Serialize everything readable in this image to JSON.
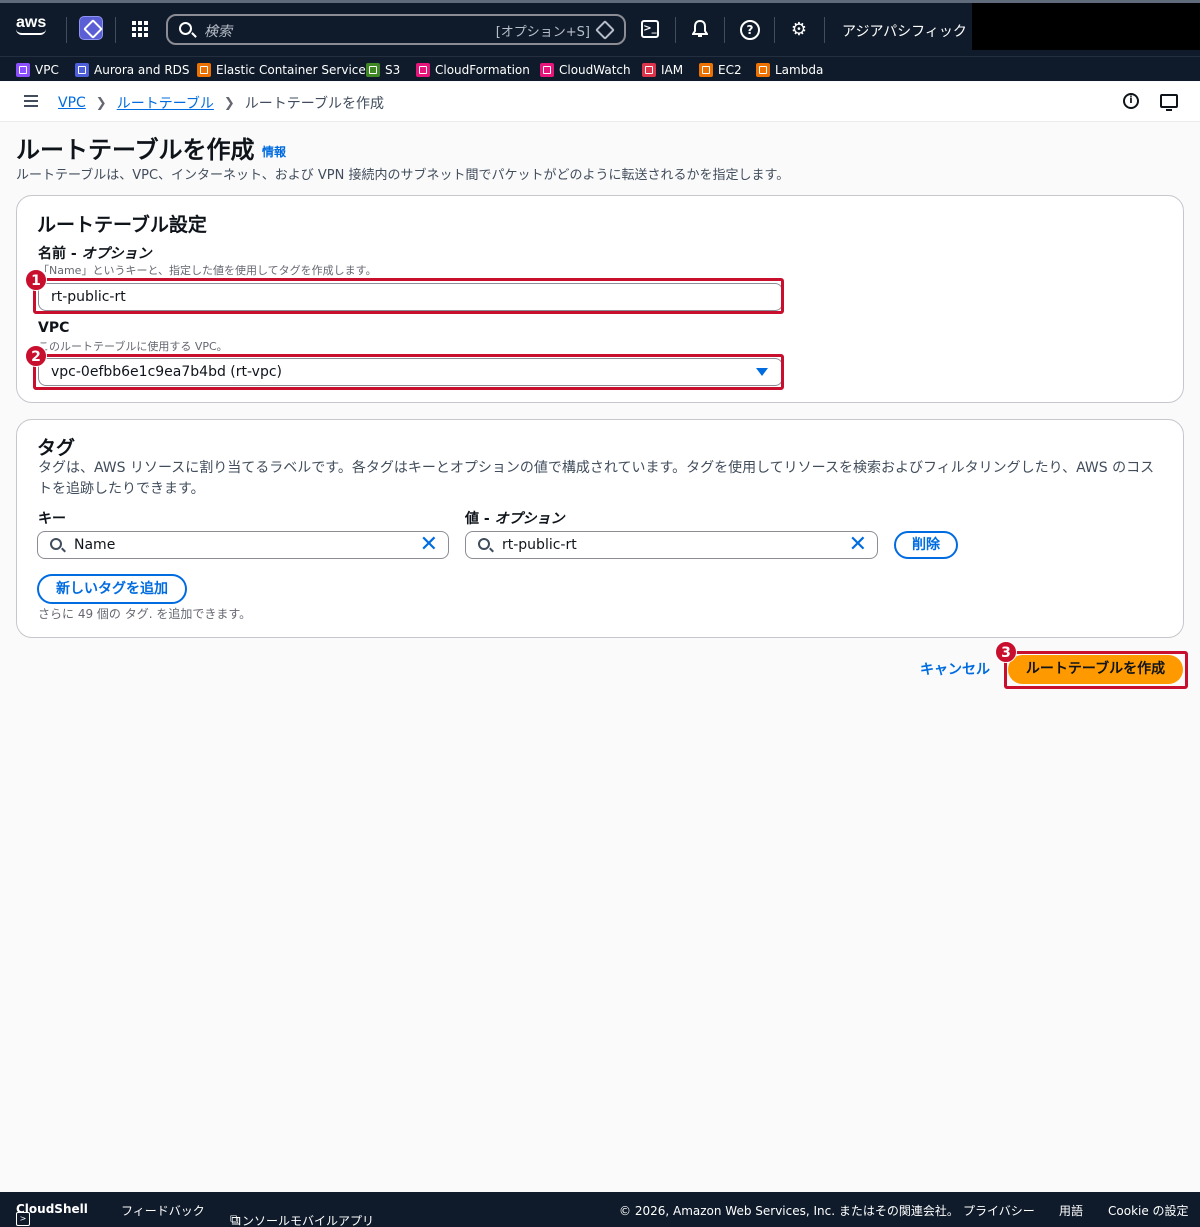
{
  "topbar": {
    "logo_text": "aws",
    "search_placeholder": "検索",
    "search_shortcut": "[オプション+S]",
    "region": "アジアパシフィック (東京)"
  },
  "favorites": [
    {
      "label": "VPC",
      "color": "#8c4fff"
    },
    {
      "label": "Aurora and RDS",
      "color": "#4d5fd9"
    },
    {
      "label": "Elastic Container Service",
      "color": "#ed7100"
    },
    {
      "label": "S3",
      "color": "#3f8624"
    },
    {
      "label": "CloudFormation",
      "color": "#e7157b"
    },
    {
      "label": "CloudWatch",
      "color": "#e7157b"
    },
    {
      "label": "IAM",
      "color": "#dd344c"
    },
    {
      "label": "EC2",
      "color": "#ed7100"
    },
    {
      "label": "Lambda",
      "color": "#ed7100"
    }
  ],
  "breadcrumb": {
    "items": [
      "VPC",
      "ルートテーブル"
    ],
    "current": "ルートテーブルを作成"
  },
  "header": {
    "title": "ルートテーブルを作成",
    "info": "情報",
    "description": "ルートテーブルは、VPC、インターネット、および VPN 接続内のサブネット間でパケットがどのように転送されるかを指定します。"
  },
  "settings": {
    "title": "ルートテーブル設定",
    "name_label": "名前",
    "name_optional": "オプション",
    "name_desc": "「Name」というキーと、指定した値を使用してタグを作成します。",
    "name_value": "rt-public-rt",
    "vpc_label": "VPC",
    "vpc_desc": "このルートテーブルに使用する VPC。",
    "vpc_value": "vpc-0efbb6e1c9ea7b4bd (rt-vpc)"
  },
  "tags": {
    "title": "タグ",
    "description": "タグは、AWS リソースに割り当てるラベルです。各タグはキーとオプションの値で構成されています。タグを使用してリソースを検索およびフィルタリングしたり、AWS のコストを追跡したりできます。",
    "key_label": "キー",
    "value_label": "値",
    "value_optional": "オプション",
    "key_value": "Name",
    "value_value": "rt-public-rt",
    "remove_label": "削除",
    "add_label": "新しいタグを追加",
    "hint": "さらに 49 個の タグ. を追加できます。"
  },
  "actions": {
    "cancel": "キャンセル",
    "create": "ルートテーブルを作成"
  },
  "annotations": [
    "1",
    "2",
    "3"
  ],
  "footer": {
    "cloudshell": "CloudShell",
    "feedback": "フィードバック",
    "mobile": "コンソールモバイルアプリ",
    "copyright": "© 2026, Amazon Web Services, Inc. またはその関連会社。",
    "privacy": "プライバシー",
    "terms": "用語",
    "cookie": "Cookie の設定"
  }
}
